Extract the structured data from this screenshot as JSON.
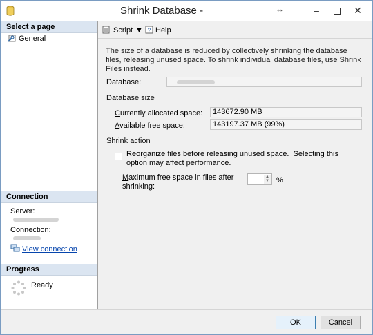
{
  "window": {
    "title": "Shrink Database -"
  },
  "sidebar": {
    "select_page_header": "Select a page",
    "pages": [
      {
        "label": "General"
      }
    ],
    "connection": {
      "header": "Connection",
      "server_label": "Server:",
      "connection_label": "Connection:",
      "view_connection_link": "View connection"
    },
    "progress": {
      "header": "Progress",
      "status": "Ready"
    }
  },
  "toolbar": {
    "script_label": "Script",
    "help_label": "Help"
  },
  "general": {
    "description": "The size of a database is reduced by collectively shrinking the database files, releasing unused space. To shrink individual database files, use Shrink Files instead.",
    "database_label": "Database:",
    "database_size_heading": "Database size",
    "allocated_label": "Currently allocated space:",
    "allocated_value": "143672.90 MB",
    "free_label": "Available free space:",
    "free_value": "143197.37 MB (99%)",
    "shrink_action_heading": "Shrink action",
    "reorganize_line1": "Reorganize files before releasing unused space.  Selecting this",
    "reorganize_line2": "option may affect performance.",
    "reorganize_checked": false,
    "max_free_line1": "Maximum free space in files after",
    "max_free_line2": "shrinking:",
    "max_free_value": "",
    "percent_symbol": "%"
  },
  "footer": {
    "ok_label": "OK",
    "cancel_label": "Cancel"
  },
  "colors": {
    "section_header": "#dbe5f1",
    "link": "#0645ad",
    "primary_border": "#3c7fb1"
  }
}
